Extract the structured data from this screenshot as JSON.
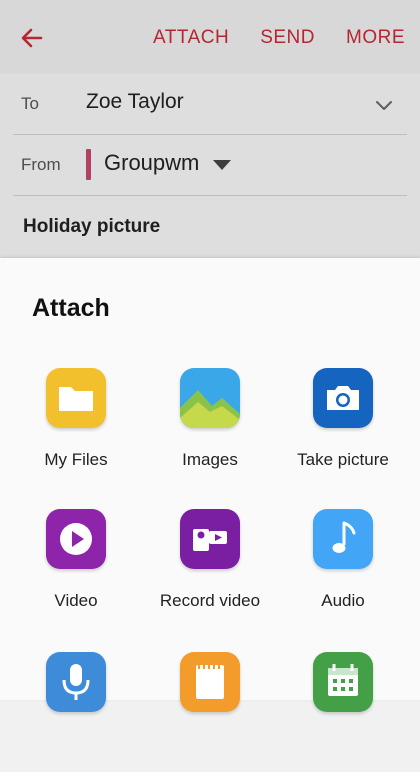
{
  "toolbar": {
    "attach": "ATTACH",
    "send": "SEND",
    "more": "MORE"
  },
  "compose": {
    "to_label": "To",
    "to_value": "Zoe Taylor",
    "from_label": "From",
    "from_value": "Groupwm",
    "subject": "Holiday picture"
  },
  "attach_sheet": {
    "title": "Attach",
    "items": [
      {
        "label": "My Files",
        "icon": "folder-icon"
      },
      {
        "label": "Images",
        "icon": "images-icon"
      },
      {
        "label": "Take picture",
        "icon": "camera-icon"
      },
      {
        "label": "Video",
        "icon": "video-play-icon"
      },
      {
        "label": "Record video",
        "icon": "video-recorder-icon"
      },
      {
        "label": "Audio",
        "icon": "music-note-icon"
      },
      {
        "label": "",
        "icon": "microphone-icon"
      },
      {
        "label": "",
        "icon": "memo-icon"
      },
      {
        "label": "",
        "icon": "calendar-icon"
      }
    ]
  },
  "colors": {
    "accent": "#c42b37",
    "from_bar": "#c0466a"
  }
}
